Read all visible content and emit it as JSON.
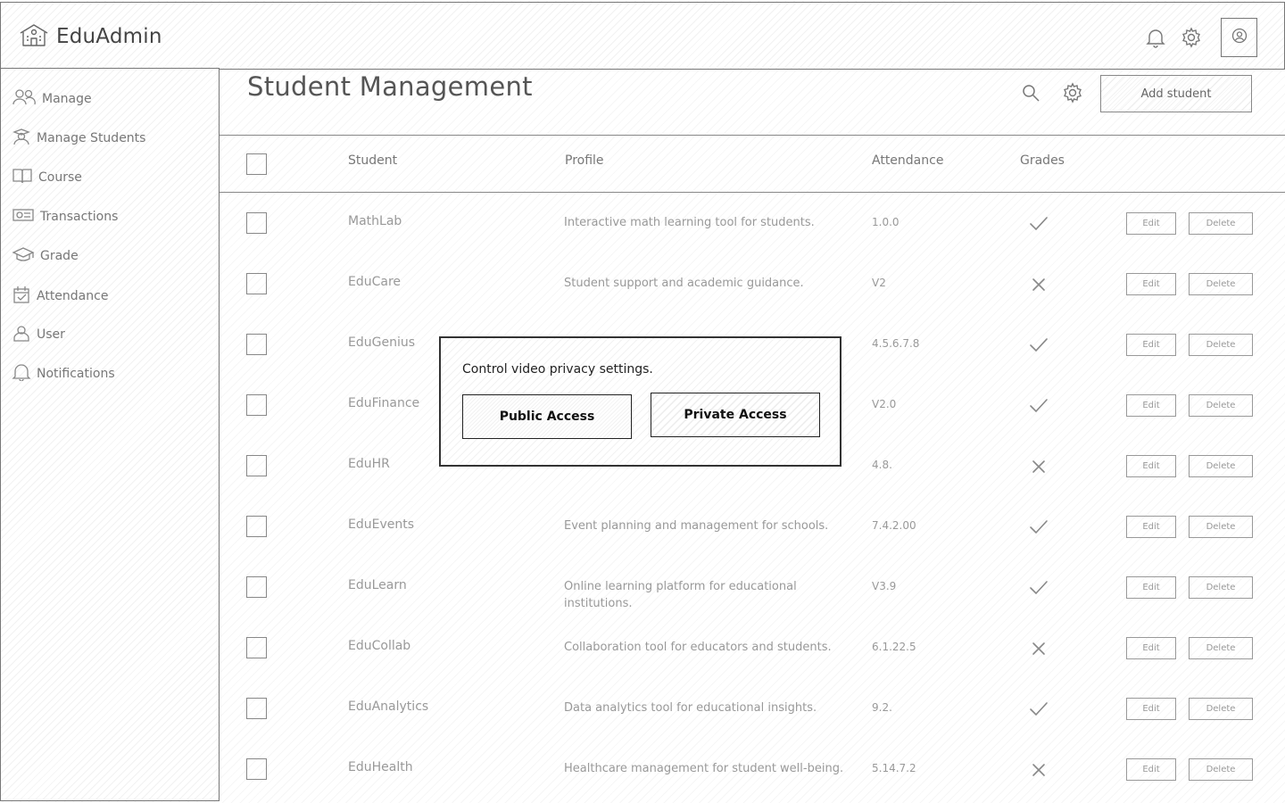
{
  "app": {
    "name": "EduAdmin"
  },
  "header": {
    "icons": [
      "bell-icon",
      "gear-icon",
      "user-avatar-icon"
    ]
  },
  "sidebar": {
    "items": [
      {
        "label": "Manage",
        "icon": "users-icon"
      },
      {
        "label": "Manage Students",
        "icon": "student-icon"
      },
      {
        "label": "Course",
        "icon": "book-icon"
      },
      {
        "label": "Transactions",
        "icon": "money-icon"
      },
      {
        "label": "Grade",
        "icon": "graduation-cap-icon"
      },
      {
        "label": "Attendance",
        "icon": "calendar-icon"
      },
      {
        "label": "User",
        "icon": "user-icon"
      },
      {
        "label": "Notifications",
        "icon": "bell-icon"
      }
    ]
  },
  "main": {
    "title": "Student Management",
    "add_button": "Add student",
    "columns": {
      "student": "Student",
      "profile": "Profile",
      "attendance": "Attendance",
      "grades": "Grades"
    },
    "rows": [
      {
        "student": "MathLab",
        "profile": "Interactive math learning tool for students.",
        "attendance": "1.0.0",
        "grade": "check"
      },
      {
        "student": "EduCare",
        "profile": "Student support and academic guidance.",
        "attendance": "V2",
        "grade": "cross"
      },
      {
        "student": "EduGenius",
        "profile": "",
        "attendance": "4.5.6.7.8",
        "grade": "check"
      },
      {
        "student": "EduFinance",
        "profile": "",
        "attendance": "V2.0",
        "grade": "check"
      },
      {
        "student": "EduHR",
        "profile": "",
        "attendance": "4.8.",
        "grade": "cross"
      },
      {
        "student": "EduEvents",
        "profile": "Event planning and management for schools.",
        "attendance": "7.4.2.00",
        "grade": "check"
      },
      {
        "student": "EduLearn",
        "profile": "Online learning platform for educational institutions.",
        "attendance": "V3.9",
        "grade": "check"
      },
      {
        "student": "EduCollab",
        "profile": "Collaboration tool for educators and students.",
        "attendance": "6.1.22.5",
        "grade": "cross"
      },
      {
        "student": "EduAnalytics",
        "profile": "Data analytics tool for educational insights.",
        "attendance": "9.2.",
        "grade": "check"
      },
      {
        "student": "EduHealth",
        "profile": "Healthcare management for student well-being.",
        "attendance": "5.14.7.2",
        "grade": "cross"
      }
    ],
    "edit_label": "Edit",
    "delete_label": "Delete"
  },
  "modal": {
    "message": "Control video privacy settings.",
    "public_label": "Public Access",
    "private_label": "Private Access"
  }
}
